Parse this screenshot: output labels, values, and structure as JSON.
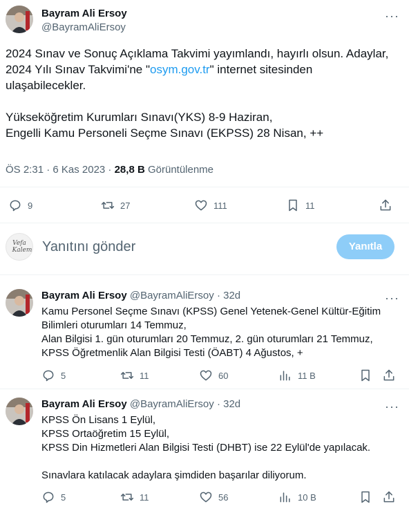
{
  "main_tweet": {
    "author_name": "Bayram Ali Ersoy",
    "author_handle": "@BayramAliErsoy",
    "text_line1": "2024 Sınav ve Sonuç Açıklama Takvimi yayımlandı, hayırlı olsun. Adaylar,",
    "text_line2_pre": "2024 Yılı Sınav Takvimi'ne \"",
    "text_link": "osym.gov.tr",
    "text_line2_post": "\" internet sitesinden",
    "text_line3": "ulaşabilecekler.",
    "text_line4": "Yükseköğretim Kurumları Sınavı(YKS) 8-9 Haziran,",
    "text_line5": "Engelli Kamu Personeli Seçme Sınavı (EKPSS) 28 Nisan, ++",
    "timestamp": "ÖS 2:31 · 6 Kas 2023 ·",
    "views_count": "28,8 B",
    "views_label": "Görüntülenme",
    "replies": "9",
    "retweets": "27",
    "likes": "111",
    "bookmarks": "11"
  },
  "compose": {
    "placeholder": "Yanıtını gönder",
    "button_label": "Yanıtla",
    "avatar_text_1": "Vefa",
    "avatar_text_2": "Kalem"
  },
  "replies": [
    {
      "author_name": "Bayram Ali Ersoy",
      "author_handle": "@BayramAliErsoy",
      "age": "· 32d",
      "lines": [
        "Kamu Personel Seçme Sınavı (KPSS) Genel Yetenek-Genel Kültür-Eğitim",
        "Bilimleri oturumları 14 Temmuz,",
        "Alan Bilgisi 1. gün oturumları 20 Temmuz, 2. gün oturumları 21 Temmuz,",
        "KPSS Öğretmenlik Alan Bilgisi Testi (ÖABT) 4 Ağustos, +"
      ],
      "replies": "5",
      "retweets": "11",
      "likes": "60",
      "views": "11 B"
    },
    {
      "author_name": "Bayram Ali Ersoy",
      "author_handle": "@BayramAliErsoy",
      "age": "· 32d",
      "lines": [
        "KPSS Ön Lisans 1 Eylül,",
        "KPSS Ortaöğretim 15 Eylül,",
        "KPSS Din Hizmetleri Alan Bilgisi Testi (DHBT) ise 22 Eylül'de yapılacak.",
        "",
        "Sınavlara katılacak adaylara şimdiden başarılar diliyorum."
      ],
      "replies": "5",
      "retweets": "11",
      "likes": "56",
      "views": "10 B"
    }
  ]
}
